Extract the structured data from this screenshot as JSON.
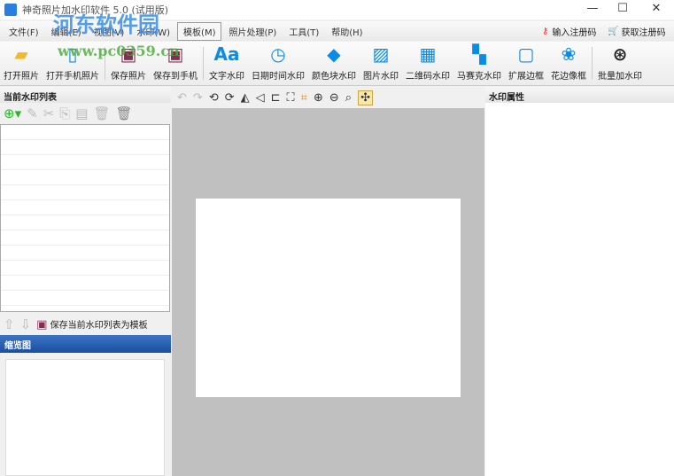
{
  "window": {
    "title": "神奇照片加水印软件 5.0 (试用版)",
    "minimize": "—",
    "maximize": "☐",
    "close": "✕"
  },
  "menu": [
    "文件(F)",
    "编辑(E)",
    "视图(V)",
    "水印(W)",
    "模板(M)",
    "照片处理(P)",
    "工具(T)",
    "帮助(H)"
  ],
  "register": {
    "enter": "输入注册码",
    "get": "获取注册码"
  },
  "toolbar": [
    {
      "label": "打开照片",
      "icon": "folder-icon"
    },
    {
      "label": "打开手机照片",
      "icon": "phone-icon"
    },
    {
      "label": "保存照片",
      "icon": "save-icon"
    },
    {
      "label": "保存到手机",
      "icon": "save-phone-icon"
    },
    {
      "label": "文字水印",
      "icon": "Aa"
    },
    {
      "label": "日期时间水印",
      "icon": "clock-icon"
    },
    {
      "label": "颜色块水印",
      "icon": "paint-bucket-icon"
    },
    {
      "label": "图片水印",
      "icon": "image-icon"
    },
    {
      "label": "二维码水印",
      "icon": "qrcode-icon"
    },
    {
      "label": "马赛克水印",
      "icon": "mosaic-icon"
    },
    {
      "label": "扩展边框",
      "icon": "border-icon"
    },
    {
      "label": "花边像框",
      "icon": "frame-icon"
    },
    {
      "label": "批量加水印",
      "icon": "batch-icon"
    }
  ],
  "left": {
    "list_title": "当前水印列表",
    "save_template": "保存当前水印列表为模板",
    "thumb_title": "缩览图"
  },
  "right": {
    "title": "水印属性"
  },
  "watermark": {
    "line1": "河东软件园",
    "line2": "www.pc0359.cn"
  },
  "colors": {
    "accent": "#0a8be8",
    "canvas": "#c0c0c0",
    "thumb_header": "#1b4fa0"
  }
}
